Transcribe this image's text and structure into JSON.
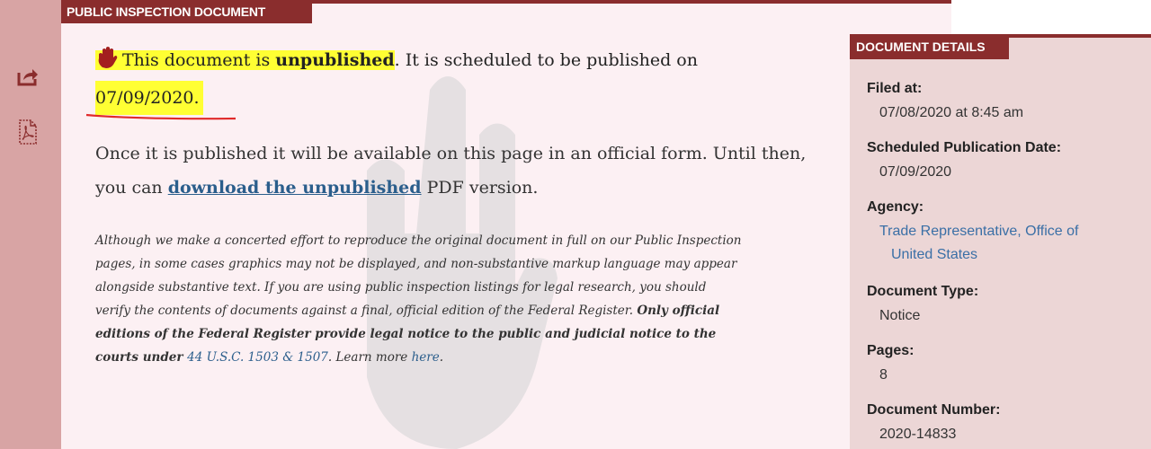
{
  "left_rail": {
    "icons": [
      "share-icon",
      "pdf-document-icon"
    ]
  },
  "main": {
    "section_tab": "PUBLIC INSPECTION DOCUMENT",
    "notice": {
      "prefix": "This document is ",
      "status": "unpublished",
      "suffix": ". It is scheduled to be published on",
      "date": "07/09/2020."
    },
    "info": {
      "line_start": "Once it is published it will be available on this page in an official form. Until then, you can ",
      "link_text": "download the unpublished",
      "line_end": " PDF version."
    },
    "disclaimer": {
      "text1": "Although we make a concerted effort to reproduce the original document in full on our Public Inspection pages, in some cases graphics may not be displayed, and non-substantive markup language may appear alongside substantive text. If you are using public inspection listings for legal research, you should verify the contents of documents against a final, official edition of the Federal Register. ",
      "bold_text": "Only official editions of the Federal Register provide legal notice to the public and judicial notice to the courts under ",
      "law_link": "44 U.S.C. 1503 & 1507",
      "text2": ". Learn more ",
      "here_link": "here",
      "text3": "."
    }
  },
  "details": {
    "tab": "DOCUMENT DETAILS",
    "filed_label": "Filed at:",
    "filed_value": "07/08/2020 at 8:45 am",
    "sched_label": "Scheduled Publication Date:",
    "sched_value": "07/09/2020",
    "agency_label": "Agency:",
    "agency_line1": "Trade Representative, Office of",
    "agency_line2": "United States",
    "type_label": "Document Type:",
    "type_value": "Notice",
    "pages_label": "Pages:",
    "pages_value": "8",
    "number_label": "Document Number:",
    "number_value": "2020-14833"
  },
  "colors": {
    "accent": "#8a2d2d",
    "rail": "#d8a4a4",
    "panel_bg": "#fcf0f3",
    "details_bg": "#ecd6d6",
    "highlight": "#ffff33",
    "link": "#2b5e8c"
  }
}
